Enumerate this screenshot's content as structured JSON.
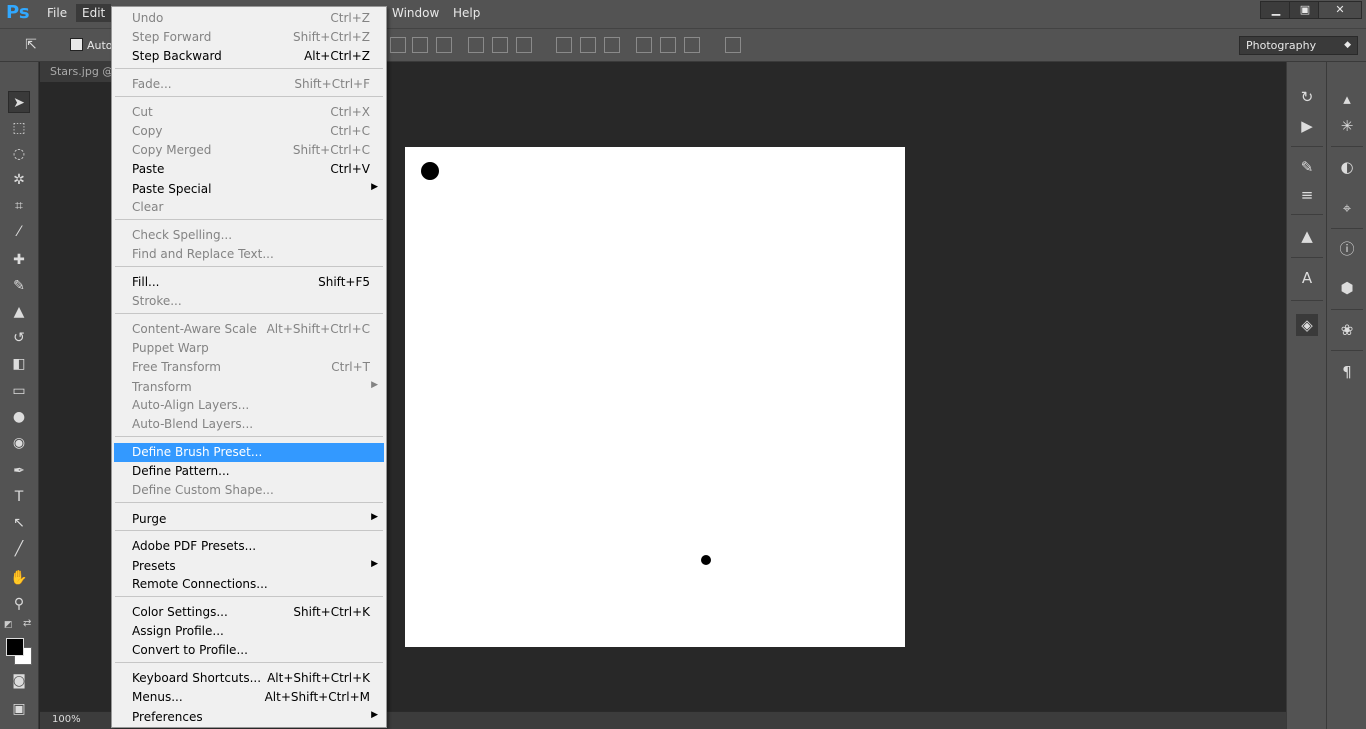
{
  "app": {
    "logo": "Ps"
  },
  "menubar": {
    "file": "File",
    "edit": "Edit",
    "window": "Window",
    "help": "Help",
    "minimize": "▁",
    "restore": "▣",
    "close": "✕"
  },
  "options": {
    "auto_select_label": "Auto-",
    "workspace": "Photography"
  },
  "document": {
    "tab_title": "Stars.jpg @",
    "zoom": "100%"
  },
  "edit_menu": {
    "undo": {
      "label": "Undo",
      "shortcut": "Ctrl+Z"
    },
    "step_forward": {
      "label": "Step Forward",
      "shortcut": "Shift+Ctrl+Z"
    },
    "step_backward": {
      "label": "Step Backward",
      "shortcut": "Alt+Ctrl+Z"
    },
    "fade": {
      "label": "Fade...",
      "shortcut": "Shift+Ctrl+F"
    },
    "cut": {
      "label": "Cut",
      "shortcut": "Ctrl+X"
    },
    "copy": {
      "label": "Copy",
      "shortcut": "Ctrl+C"
    },
    "copy_merged": {
      "label": "Copy Merged",
      "shortcut": "Shift+Ctrl+C"
    },
    "paste": {
      "label": "Paste",
      "shortcut": "Ctrl+V"
    },
    "paste_special": {
      "label": "Paste Special"
    },
    "clear": {
      "label": "Clear"
    },
    "check_spelling": {
      "label": "Check Spelling..."
    },
    "find_replace": {
      "label": "Find and Replace Text..."
    },
    "fill": {
      "label": "Fill...",
      "shortcut": "Shift+F5"
    },
    "stroke": {
      "label": "Stroke..."
    },
    "content_aware_scale": {
      "label": "Content-Aware Scale",
      "shortcut": "Alt+Shift+Ctrl+C"
    },
    "puppet_warp": {
      "label": "Puppet Warp"
    },
    "free_transform": {
      "label": "Free Transform",
      "shortcut": "Ctrl+T"
    },
    "transform": {
      "label": "Transform"
    },
    "auto_align": {
      "label": "Auto-Align Layers..."
    },
    "auto_blend": {
      "label": "Auto-Blend Layers..."
    },
    "define_brush": {
      "label": "Define Brush Preset..."
    },
    "define_pattern": {
      "label": "Define Pattern..."
    },
    "define_shape": {
      "label": "Define Custom Shape..."
    },
    "purge": {
      "label": "Purge"
    },
    "pdf_presets": {
      "label": "Adobe PDF Presets..."
    },
    "presets": {
      "label": "Presets"
    },
    "remote_connections": {
      "label": "Remote Connections..."
    },
    "color_settings": {
      "label": "Color Settings...",
      "shortcut": "Shift+Ctrl+K"
    },
    "assign_profile": {
      "label": "Assign Profile..."
    },
    "convert_profile": {
      "label": "Convert to Profile..."
    },
    "keyboard_shortcuts": {
      "label": "Keyboard Shortcuts...",
      "shortcut": "Alt+Shift+Ctrl+K"
    },
    "menus": {
      "label": "Menus...",
      "shortcut": "Alt+Shift+Ctrl+M"
    },
    "preferences": {
      "label": "Preferences"
    }
  },
  "colors": {
    "highlight": "#3399ff",
    "chrome": "#535353",
    "workspace_bg": "#282828",
    "foreground": "#000000",
    "background": "#ffffff"
  }
}
